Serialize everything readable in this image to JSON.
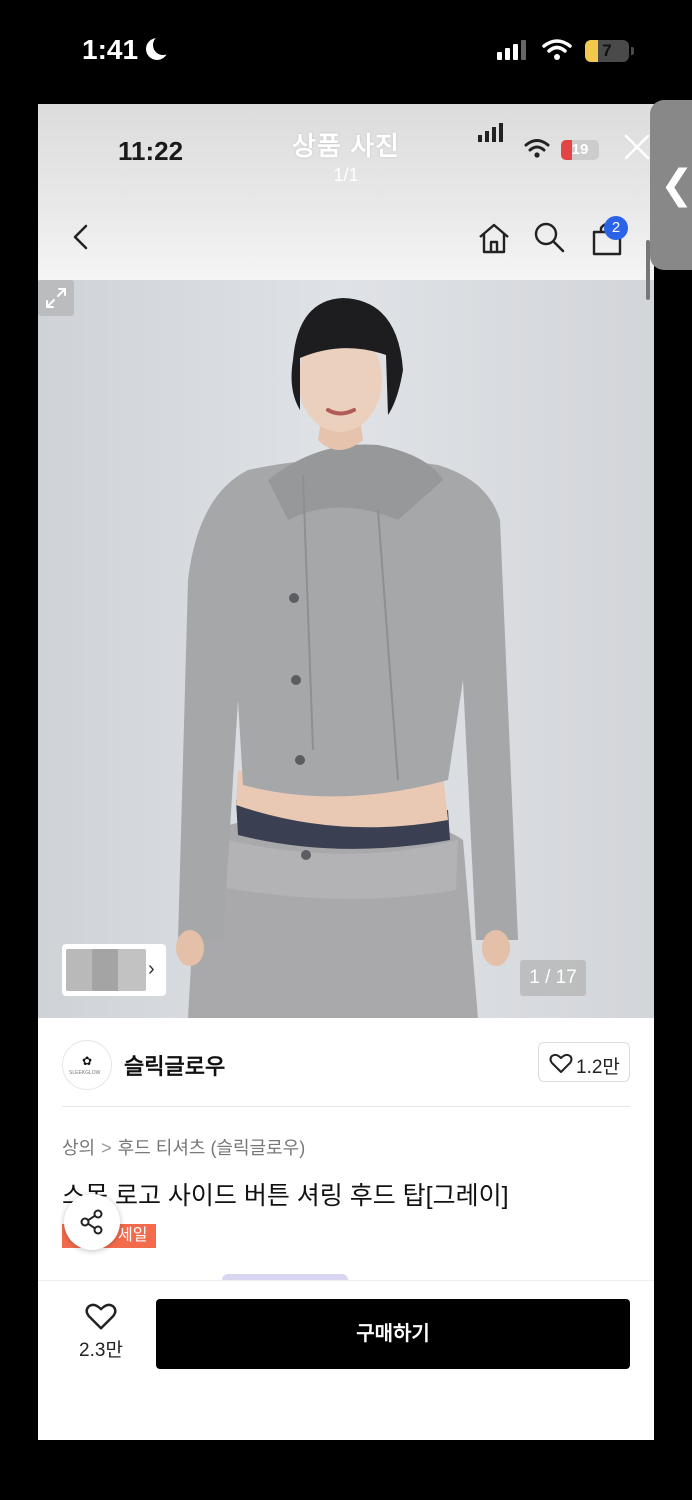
{
  "outer_status": {
    "time": "1:41",
    "battery": "7"
  },
  "viewer": {
    "time": "11:22",
    "title": "상품 사진",
    "count": "1/1",
    "battery": "19"
  },
  "nav": {
    "cart_count": "2"
  },
  "gallery": {
    "counter": "1 / 17"
  },
  "brand": {
    "name": "슬릭글로우",
    "logo_text": "SLEEKGLOW",
    "likes": "1.2만"
  },
  "breadcrumb": {
    "level1": "상의",
    "separator": ">",
    "level2": "후드 티셔츠 (슬릭글로우)"
  },
  "product": {
    "title": "스목 로고 사이드 버튼 셔링 후드 탑[그레이]",
    "badge": "세일"
  },
  "bottom": {
    "wish_count": "2.3만",
    "buy_label": "구매하기"
  },
  "side_tab": {
    "label": "❮"
  }
}
